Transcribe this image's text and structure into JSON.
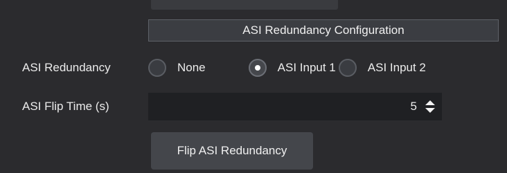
{
  "section": {
    "title": "ASI Redundancy Configuration"
  },
  "asi_redundancy": {
    "label": "ASI Redundancy",
    "options": [
      {
        "label": "None",
        "selected": false
      },
      {
        "label": "ASI Input 1",
        "selected": true
      },
      {
        "label": "ASI Input 2",
        "selected": false
      }
    ]
  },
  "flip_time": {
    "label": "ASI Flip Time (s)",
    "value": "5",
    "spinner_icon": "up-down-arrows-icon"
  },
  "flip_button": {
    "label": "Flip ASI Redundancy"
  }
}
